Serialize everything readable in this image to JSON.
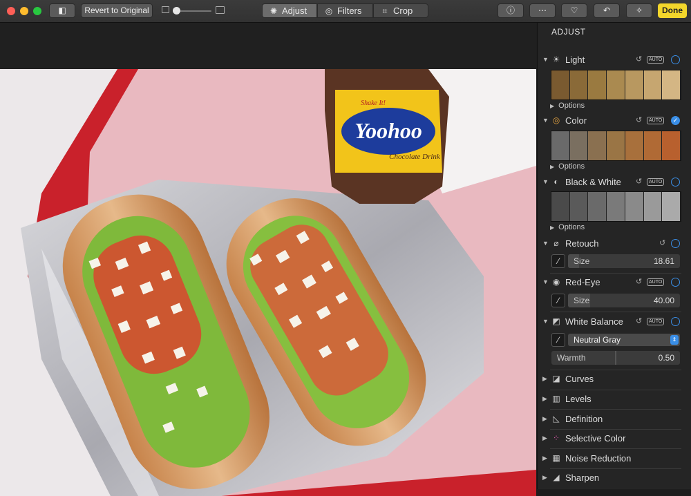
{
  "toolbar": {
    "revert_label": "Revert to Original",
    "tabs": [
      {
        "label": "Adjust",
        "icon": "adjust-dial-icon"
      },
      {
        "label": "Filters",
        "icon": "filters-icon"
      },
      {
        "label": "Crop",
        "icon": "crop-icon"
      }
    ],
    "done_label": "Done",
    "zoom_level": 0.1
  },
  "sidebar": {
    "title": "ADJUST",
    "auto_label": "AUTO",
    "options_label": "Options",
    "sections": {
      "light": {
        "label": "Light"
      },
      "color": {
        "label": "Color"
      },
      "bw": {
        "label": "Black & White"
      },
      "retouch": {
        "label": "Retouch",
        "size_label": "Size",
        "size_value": "18.61"
      },
      "redeye": {
        "label": "Red-Eye",
        "size_label": "Size",
        "size_value": "40.00"
      },
      "wb": {
        "label": "White Balance",
        "mode": "Neutral Gray",
        "warmth_label": "Warmth",
        "warmth_value": "0.50"
      },
      "curves": {
        "label": "Curves"
      },
      "levels": {
        "label": "Levels"
      },
      "definition": {
        "label": "Definition"
      },
      "selective": {
        "label": "Selective Color"
      },
      "noise": {
        "label": "Noise Reduction"
      },
      "sharpen": {
        "label": "Sharpen"
      }
    }
  },
  "photo": {
    "bottle_brand": "Yoohoo",
    "bottle_subtitle": "Chocolate Drink",
    "bottle_tagline": "Shake It!"
  },
  "colors": {
    "accent": "#3a8ee6",
    "done": "#f3d62b"
  }
}
